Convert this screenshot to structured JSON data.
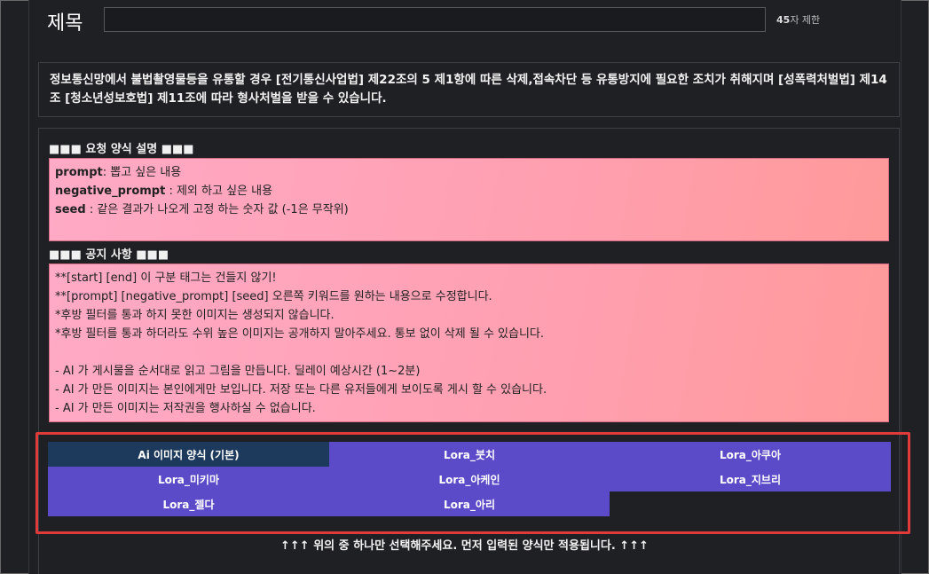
{
  "header": {
    "title_label": "제목",
    "title_value": "",
    "limit_count": "45",
    "limit_suffix": "자 제한"
  },
  "warning": {
    "text": "정보통신망에서 불법촬영물등을 유통할 경우 [전기통신사업법] 제22조의 5 제1항에 따른 삭제,접속차단 등 유통방지에 필요한 조치가 취해지며 [성폭력처벌법] 제14조 [청소년성보호법] 제11조에 따라 형사처벌을 받을 수 있습니다."
  },
  "format_section": {
    "heading": "■■■ 요청 양식 설명 ■■■",
    "lines": [
      {
        "key": "prompt",
        "text": ": 뽑고 싶은 내용"
      },
      {
        "key": "negative_prompt",
        "text": " : 제외 하고 싶은 내용"
      },
      {
        "key": "seed",
        "text": " : 같은 결과가 나오게 고정 하는 숫자 값 (-1은 무작위)"
      }
    ]
  },
  "notice_section": {
    "heading": "■■■ 공지 사항 ■■■",
    "lines": [
      "**[start] [end] 이 구분 태그는 건들지 않기!",
      "**[prompt] [negative_prompt] [seed] 오른쪽 키워드를 원하는 내용으로 수정합니다.",
      "*후방 필터를 통과 하지 못한 이미지는 생성되지 않습니다.",
      "*후방 필터를 통과 하더라도 수위 높은 이미지는 공개하지 말아주세요. 통보 없이 삭제 될 수 있습니다.",
      "",
      "- AI 가 게시물을 순서대로 읽고 그림을 만듭니다. 딜레이 예상시간 (1~2분)",
      "- AI 가 만든 이미지는 본인에게만 보입니다. 저장 또는 다른 유저들에게 보이도록 게시 할 수 있습니다.",
      "- AI 가 만든 이미지는 저작권을 행사하실 수 없습니다."
    ]
  },
  "templates": [
    {
      "label": "Ai 이미지 양식 (기본)",
      "active": true
    },
    {
      "label": "Lora_붓치",
      "active": false
    },
    {
      "label": "Lora_아쿠아",
      "active": false
    },
    {
      "label": "Lora_미키마",
      "active": false
    },
    {
      "label": "Lora_아케인",
      "active": false
    },
    {
      "label": "Lora_지브리",
      "active": false
    },
    {
      "label": "Lora_젤다",
      "active": false
    },
    {
      "label": "Lora_아리",
      "active": false
    }
  ],
  "footer": {
    "text": "↑↑↑ 위의 중 하나만 선택해주세요. 먼저 입력된 양식만 적용됩니다. ↑↑↑"
  },
  "colors": {
    "template_button": "#5b4bc9",
    "template_active": "#1d3a5c",
    "highlight_border": "#e03b3b",
    "pink_box": "#ffaac6"
  }
}
